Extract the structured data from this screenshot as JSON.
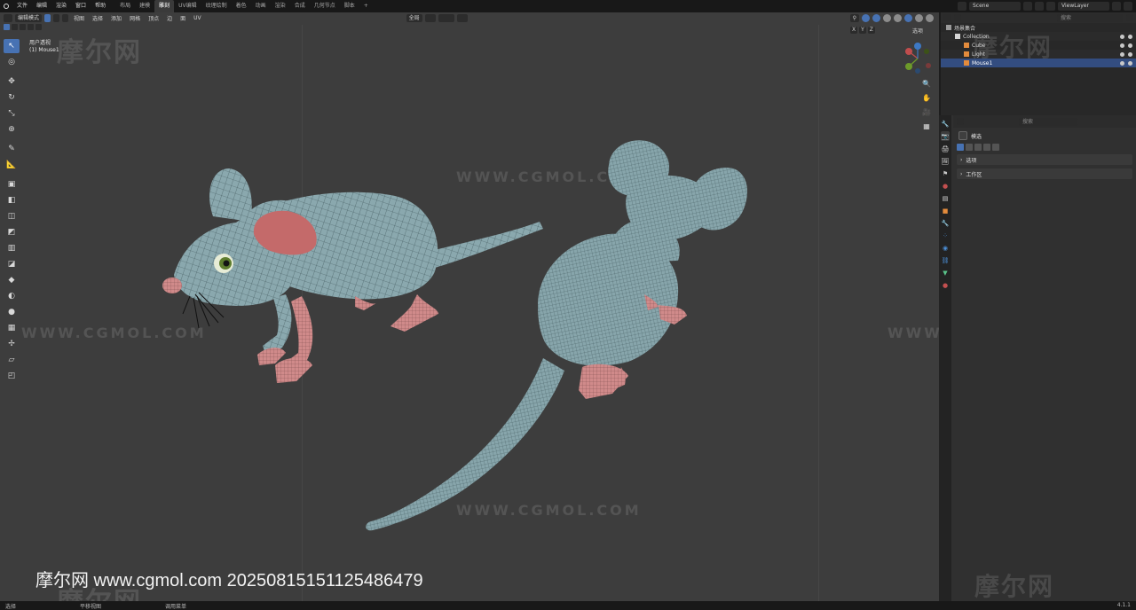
{
  "top_menu": {
    "items": [
      "文件",
      "编辑",
      "渲染",
      "窗口",
      "帮助"
    ],
    "workspace_tabs": [
      "布局",
      "建模",
      "雕刻",
      "UV编辑",
      "纹理绘制",
      "着色",
      "动画",
      "渲染",
      "合成",
      "几何节点",
      "脚本"
    ],
    "active_tab": "雕刻",
    "add_tab": "+",
    "scene": "Scene",
    "view_layer": "ViewLayer"
  },
  "viewport_header": {
    "mode": "编辑模式",
    "menus": [
      "视图",
      "选择",
      "添加",
      "网格",
      "顶点",
      "边",
      "面",
      "UV"
    ],
    "transform_orientation": "全局",
    "overlay_label": "选项"
  },
  "viewport_info": {
    "view_name": "用户透视",
    "object_name": "(1) Mouse1"
  },
  "gizmo_axes": [
    "X",
    "Y",
    "Z"
  ],
  "watermarks": {
    "cn": "摩尔网",
    "url": "WWW.CGMOL.COM",
    "footer": "摩尔网 www.cgmol.com 20250815151125486479"
  },
  "status_bar": {
    "items": [
      "选择",
      "平移视图",
      "调用菜单"
    ],
    "version": "4.1.1"
  },
  "outliner": {
    "search_placeholder": "搜索",
    "root": "场景集合",
    "collection": "Collection",
    "objects": [
      "Cube",
      "Light",
      "Mouse1"
    ],
    "selected": "Mouse1"
  },
  "properties": {
    "search_placeholder": "搜索",
    "title": "模选",
    "panels": [
      "选项",
      "工作区"
    ]
  },
  "colors": {
    "accent": "#4772b3",
    "mesh_body": "#8aa8ae",
    "mesh_pink": "#d08a8a",
    "viewport_bg": "#3d3d3d"
  }
}
